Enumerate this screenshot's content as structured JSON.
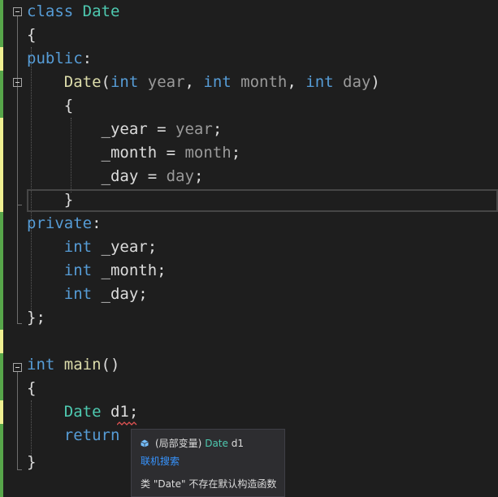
{
  "colors": {
    "background": "#1e1e1e",
    "keyword": "#569cd6",
    "type": "#4ec9b0",
    "function": "#dcdcaa",
    "parameter": "#9a9a9a",
    "text": "#dcdcdc",
    "change_saved": "#57a64a",
    "change_unsaved": "#efef91",
    "link": "#3794ff"
  },
  "code": {
    "l1": {
      "kw": "class",
      "sp": " ",
      "name": "Date"
    },
    "l2": {
      "brace": "{"
    },
    "l3": {
      "kw": "public",
      "colon": ":"
    },
    "l4": {
      "indent": "    ",
      "name": "Date",
      "open": "(",
      "t1": "int",
      "p1": " year",
      "c1": ", ",
      "t2": "int",
      "p2": " month",
      "c2": ", ",
      "t3": "int",
      "p3": " day",
      "close": ")"
    },
    "l5": {
      "indent": "    ",
      "brace": "{"
    },
    "l6": {
      "indent": "        ",
      "member": "_year",
      "op": " = ",
      "param": "year",
      "semi": ";"
    },
    "l7": {
      "indent": "        ",
      "member": "_month",
      "op": " = ",
      "param": "month",
      "semi": ";"
    },
    "l8": {
      "indent": "        ",
      "member": "_day",
      "op": " = ",
      "param": "day",
      "semi": ";"
    },
    "l9": {
      "indent": "    ",
      "brace": "}"
    },
    "l10": {
      "kw": "private",
      "colon": ":"
    },
    "l11": {
      "indent": "    ",
      "type": "int",
      "rest": " _year;"
    },
    "l12": {
      "indent": "    ",
      "type": "int",
      "rest": " _month;"
    },
    "l13": {
      "indent": "    ",
      "type": "int",
      "rest": " _day;"
    },
    "l14": {
      "text": "};"
    },
    "l16": {
      "type": "int",
      "sp": " ",
      "name": "main",
      "rest": "()"
    },
    "l17": {
      "brace": "{"
    },
    "l18": {
      "indent": "    ",
      "type": "Date",
      "sp": " ",
      "var": "d1",
      "semi": ";"
    },
    "l19": {
      "indent": "    ",
      "kw": "return"
    },
    "l20": {
      "brace": "}"
    }
  },
  "tooltip": {
    "icon": "local-variable-icon",
    "scope": "(局部变量)",
    "type": "Date",
    "name": " d1",
    "link": "联机搜索",
    "error": "类 \"Date\" 不存在默认构造函数"
  }
}
